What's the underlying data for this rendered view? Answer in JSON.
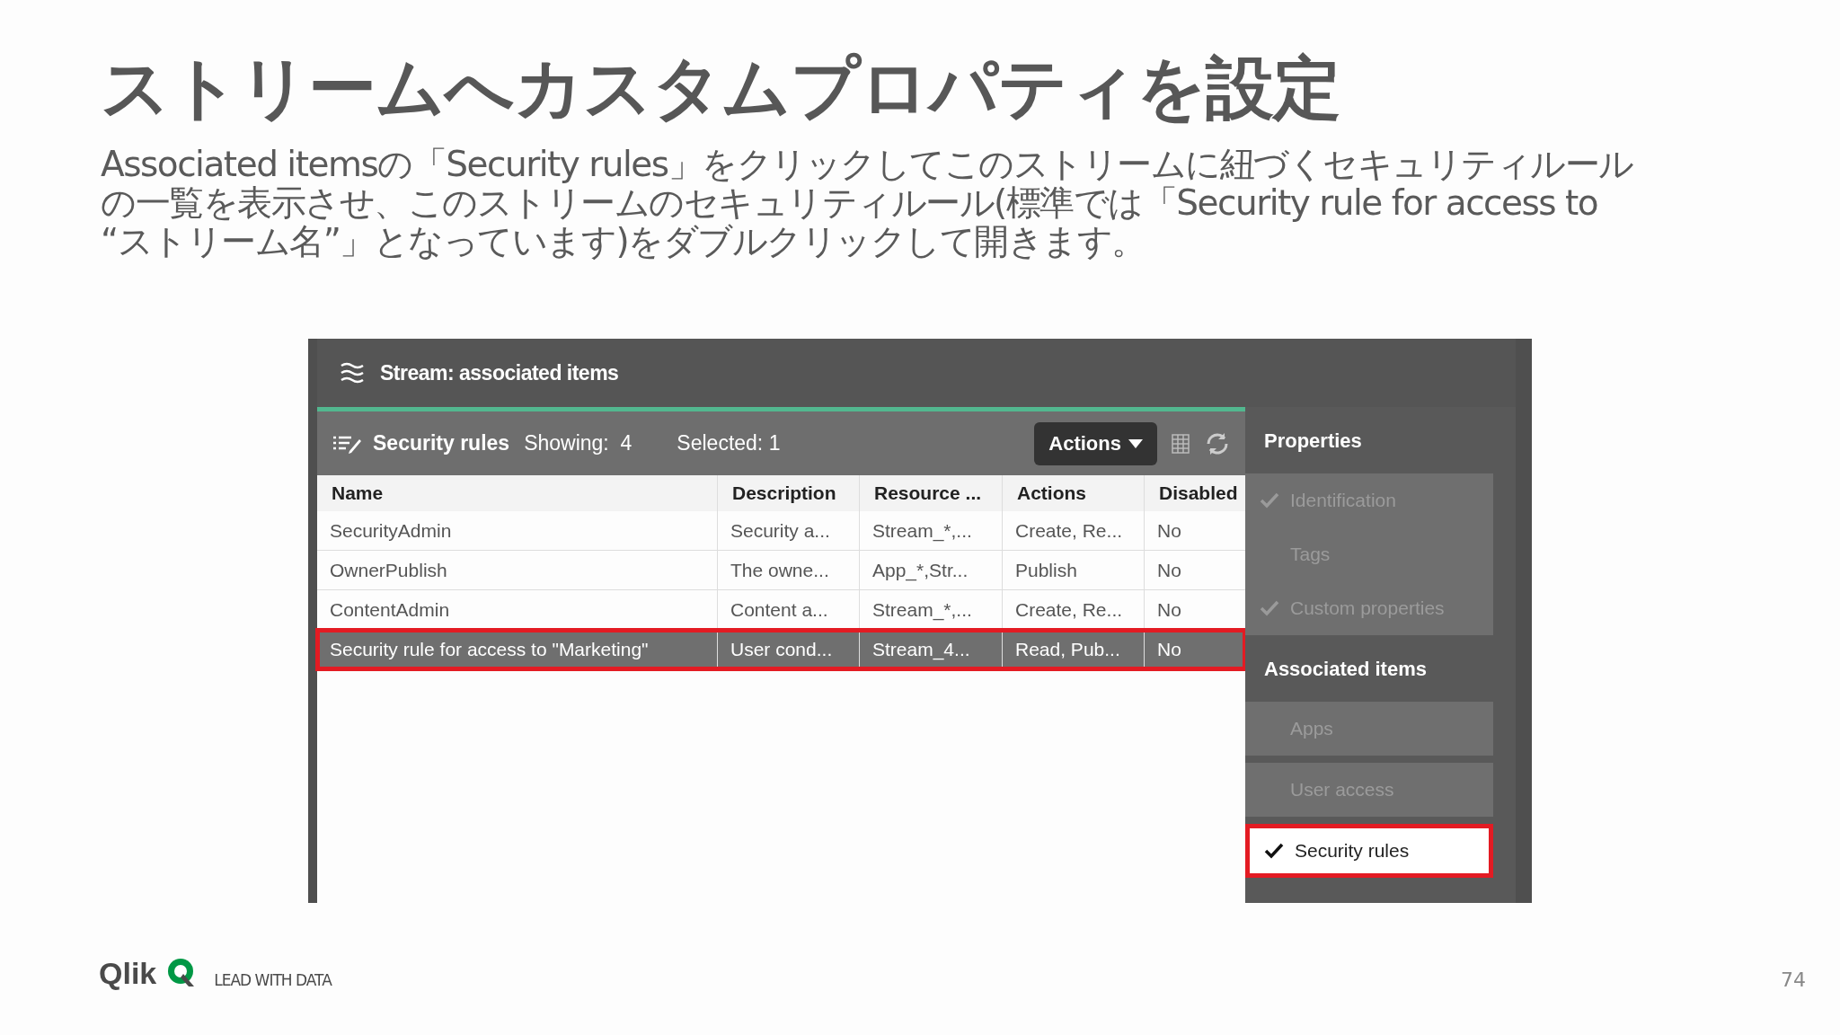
{
  "slide": {
    "title": "ストリームへカスタムプロパティを設定",
    "body_lines": [
      "Associated itemsの「Security rules」をクリックしてこのストリームに紐づくセキュリティルール",
      "の一覧を表示させ、このストリームのセキュリティルール(標準では「Security rule for access to",
      "“ストリーム名”」となっています)をダブルクリックして開きます。"
    ]
  },
  "window": {
    "title": "Stream: associated items",
    "toolbar": {
      "list_name": "Security rules",
      "showing": "Showing:  4",
      "selected_count": "Selected: 1",
      "actions_button": "Actions"
    },
    "table": {
      "columns": [
        "Name",
        "Description",
        "Resource ...",
        "Actions",
        "Disabled"
      ],
      "rows": [
        {
          "cells": [
            "SecurityAdmin",
            "Security a...",
            "Stream_*,...",
            "Create, Re...",
            "No"
          ],
          "selected": false,
          "highlighted": false
        },
        {
          "cells": [
            "OwnerPublish",
            "The owne...",
            "App_*,Str...",
            "Publish",
            "No"
          ],
          "selected": false,
          "highlighted": false
        },
        {
          "cells": [
            "ContentAdmin",
            "Content a...",
            "Stream_*,...",
            "Create, Re...",
            "No"
          ],
          "selected": false,
          "highlighted": false
        },
        {
          "cells": [
            "Security rule for access to \"Marketing\"",
            "User cond...",
            "Stream_4...",
            "Read, Pub...",
            "No"
          ],
          "selected": true,
          "highlighted": true
        }
      ]
    }
  },
  "sidebar": {
    "sections": [
      {
        "title": "Properties",
        "items": [
          {
            "label": "Identification",
            "checked": true,
            "selected": false,
            "highlighted": false
          },
          {
            "label": "Tags",
            "checked": false,
            "selected": false,
            "highlighted": false
          },
          {
            "label": "Custom properties",
            "checked": true,
            "selected": false,
            "highlighted": false
          }
        ]
      },
      {
        "title": "Associated items",
        "items": [
          {
            "label": "Apps",
            "checked": false,
            "selected": false,
            "highlighted": false
          },
          {
            "label": "User access",
            "checked": false,
            "selected": false,
            "highlighted": false
          },
          {
            "label": "Security rules",
            "checked": true,
            "selected": true,
            "highlighted": true
          }
        ]
      }
    ]
  },
  "footer": {
    "logo": "Qlik",
    "tagline": "LEAD WITH DATA",
    "page": "74"
  }
}
